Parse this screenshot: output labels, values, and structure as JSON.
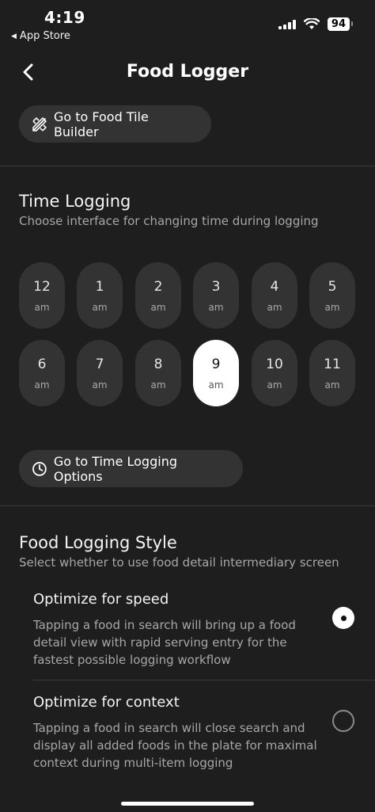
{
  "status": {
    "time": "4:19",
    "back_app": "App Store",
    "battery": "94"
  },
  "nav": {
    "title": "Food Logger"
  },
  "tile_builder_button": "Go to Food Tile Builder",
  "time_logging": {
    "title": "Time Logging",
    "subtitle": "Choose interface for changing time during logging",
    "hours": [
      {
        "num": "12",
        "ampm": "am"
      },
      {
        "num": "1",
        "ampm": "am"
      },
      {
        "num": "2",
        "ampm": "am"
      },
      {
        "num": "3",
        "ampm": "am"
      },
      {
        "num": "4",
        "ampm": "am"
      },
      {
        "num": "5",
        "ampm": "am"
      },
      {
        "num": "6",
        "ampm": "am"
      },
      {
        "num": "7",
        "ampm": "am"
      },
      {
        "num": "8",
        "ampm": "am"
      },
      {
        "num": "9",
        "ampm": "am"
      },
      {
        "num": "10",
        "ampm": "am"
      },
      {
        "num": "11",
        "ampm": "am"
      }
    ],
    "selected_hour": "9",
    "options_button": "Go to Time Logging Options"
  },
  "food_logging_style": {
    "title": "Food Logging Style",
    "subtitle": "Select whether to use food detail intermediary screen",
    "options": [
      {
        "title": "Optimize for speed",
        "description": "Tapping a food in search will bring up a food detail view with rapid serving entry for the fastest possible logging workflow",
        "selected": true
      },
      {
        "title": "Optimize for context",
        "description": "Tapping a food in search will close search and display all added foods in the plate for maximal context during multi-item logging",
        "selected": false
      }
    ]
  },
  "colors": {
    "background": "#1e1e1e",
    "pill": "#333333",
    "selected_hour_bg": "#ffffff",
    "secondary_text": "#a7a7a7"
  },
  "icons": {
    "back_app": "left-triangle-icon",
    "signal": "cellular-signal-icon",
    "wifi": "wifi-icon",
    "battery": "battery-icon",
    "nav_back": "chevron-left-icon",
    "tile_builder": "pencil-ruler-icon",
    "time_options": "clock-icon"
  }
}
